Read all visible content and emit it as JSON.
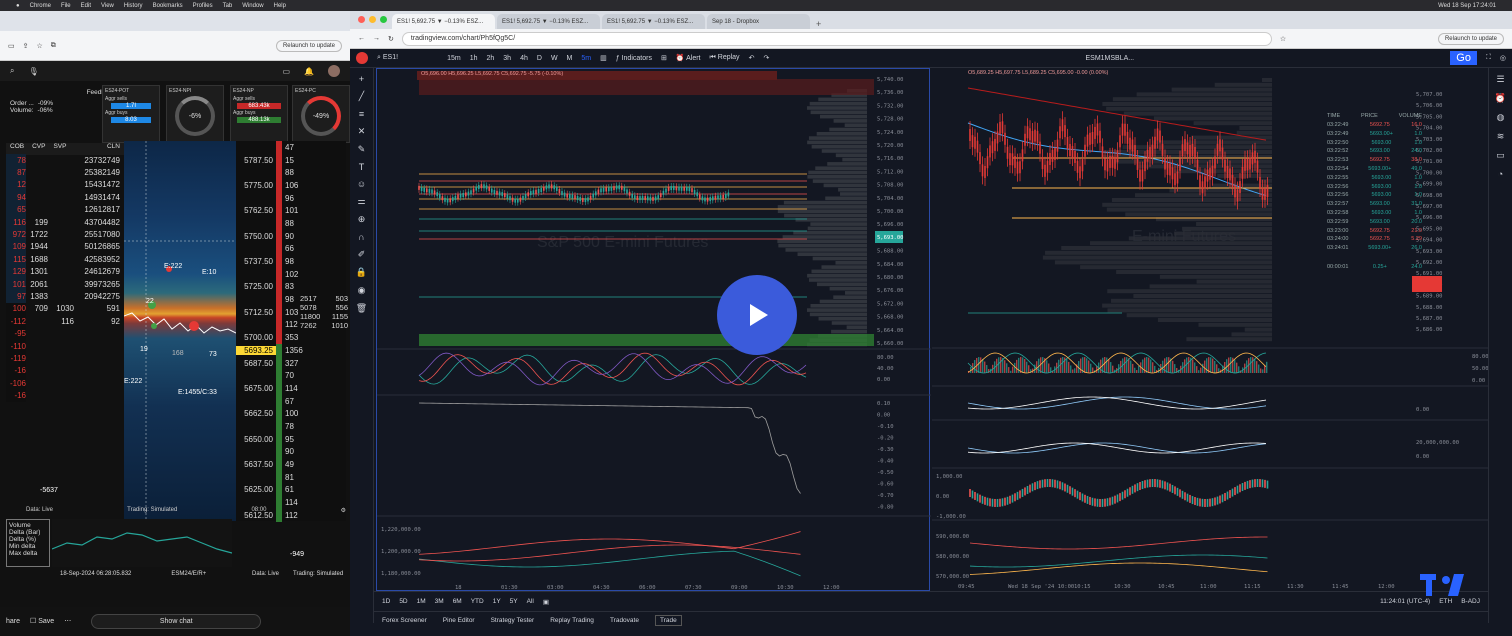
{
  "macbar": {
    "app": "Chrome",
    "menus": [
      "File",
      "Edit",
      "View",
      "History",
      "Bookmarks",
      "Profiles",
      "Tab",
      "Window",
      "Help"
    ],
    "clock": "Wed 18 Sep  17:24:01"
  },
  "left": {
    "url_relaunch": "Relaunch to update",
    "feedback": "Feedb",
    "order_label": "Order ...",
    "order_val": "-09%",
    "volume_label": "Volume:",
    "volume_val": "-06%",
    "gauges": [
      {
        "title": "ES24-POT",
        "a": "Aggr sells",
        "av": "1.7I",
        "b": "Aggr buys",
        "bv": "8.03"
      },
      {
        "title": "ES24-NPI",
        "val": "-6%",
        "sub": "-151.23k"
      },
      {
        "title": "ES24-NP",
        "a": "Aggr sells",
        "av": "683.43k",
        "b": "Aggr buys",
        "bv": "488.13k"
      },
      {
        "title": "ES24-PC",
        "val": "-49%",
        "sub": "5693.25"
      }
    ],
    "dom_headers": [
      "COB",
      "CVP",
      "SVP",
      "CLN"
    ],
    "dom_rows": [
      {
        "a": "78",
        "b": "",
        "c": "",
        "d": "23732749"
      },
      {
        "a": "87",
        "b": "",
        "c": "",
        "d": "25382149"
      },
      {
        "a": "12",
        "b": "",
        "c": "",
        "d": "15431472"
      },
      {
        "a": "94",
        "b": "",
        "c": "",
        "d": "14931474"
      },
      {
        "a": "65",
        "b": "",
        "c": "",
        "d": "12612817"
      },
      {
        "a": "116",
        "b": "199",
        "c": "",
        "d": "43704482"
      },
      {
        "a": "972",
        "b": "1722",
        "c": "",
        "d": "25517080"
      },
      {
        "a": "109",
        "b": "1944",
        "c": "",
        "d": "50126865"
      },
      {
        "a": "115",
        "b": "1688",
        "c": "",
        "d": "42583952"
      },
      {
        "a": "129",
        "b": "1301",
        "c": "",
        "d": "24612679"
      },
      {
        "a": "101",
        "b": "2061",
        "c": "",
        "d": "39973265"
      },
      {
        "a": "97",
        "b": "1383",
        "c": "",
        "d": "20942275"
      },
      {
        "a": "100",
        "b": "709",
        "c": "1030",
        "d": "591"
      },
      {
        "a": "-112",
        "b": "",
        "c": "116",
        "d": "92"
      },
      {
        "a": "-95",
        "b": "",
        "c": "",
        "d": ""
      },
      {
        "a": "-110",
        "b": "",
        "c": "",
        "d": ""
      },
      {
        "a": "-119",
        "b": "",
        "c": "",
        "d": ""
      },
      {
        "a": "-16",
        "b": "",
        "c": "",
        "d": ""
      },
      {
        "a": "-106",
        "b": "",
        "c": "",
        "d": ""
      },
      {
        "a": "-16",
        "b": "",
        "c": "",
        "d": ""
      }
    ],
    "heat_labels": [
      {
        "t": "E:222"
      },
      {
        "t": "E:10"
      },
      {
        "t": "22"
      },
      {
        "t": "19"
      },
      {
        "t": "168"
      },
      {
        "t": "73"
      },
      {
        "t": "E:222"
      },
      {
        "t": "E:1455/C:33"
      }
    ],
    "ladder_rows": [
      {
        "p": "",
        "v": "47"
      },
      {
        "p": "5787.50",
        "v": "15"
      },
      {
        "p": "",
        "v": "88"
      },
      {
        "p": "5775.00",
        "v": "106"
      },
      {
        "p": "",
        "v": "96"
      },
      {
        "p": "5762.50",
        "v": "101"
      },
      {
        "p": "",
        "v": "88"
      },
      {
        "p": "5750.00",
        "v": "90"
      },
      {
        "p": "",
        "v": "66"
      },
      {
        "p": "5737.50",
        "v": "98"
      },
      {
        "p": "",
        "v": "102"
      },
      {
        "p": "5725.00",
        "v": "83"
      },
      {
        "p": "",
        "v": "98"
      },
      {
        "p": "5712.50",
        "v": "103"
      },
      {
        "p": "",
        "v": "112"
      },
      {
        "p": "5700.00",
        "v": "353"
      },
      {
        "p": "5693.25",
        "v": "1356"
      },
      {
        "p": "5687.50",
        "v": "327"
      },
      {
        "p": "",
        "v": "70"
      },
      {
        "p": "5675.00",
        "v": "114"
      },
      {
        "p": "",
        "v": "67"
      },
      {
        "p": "5662.50",
        "v": "100"
      },
      {
        "p": "",
        "v": "78"
      },
      {
        "p": "5650.00",
        "v": "95"
      },
      {
        "p": "",
        "v": "90"
      },
      {
        "p": "5637.50",
        "v": "49"
      },
      {
        "p": "",
        "v": "81"
      },
      {
        "p": "5625.00",
        "v": "61"
      },
      {
        "p": "",
        "v": "114"
      },
      {
        "p": "5612.50",
        "v": "112"
      }
    ],
    "ladder_side": [
      "2517",
      "503",
      "5078",
      "556",
      "11800",
      "1155",
      "7262",
      "1010"
    ],
    "cvd_val": "-5637",
    "status_live": "Data: Live",
    "status_sim": "Trading: Simulated",
    "time_label": "08:00",
    "mini_val": "-949",
    "legend": [
      "Volume",
      "Delta (Bar)",
      "Delta (%)",
      "Min delta",
      "Max delta"
    ],
    "mini_time": "18-Sep-2024 06:28:05.832",
    "mini_sym": "ESM24/E/R+",
    "share": "hare",
    "save": "Save",
    "chat": "Show chat"
  },
  "right": {
    "tabs": [
      "ES1! 5,692.75 ▼ −0.13% ESZ...",
      "ES1! 5,692.75 ▼ −0.13% ESZ...",
      "ES1! 5,692.75 ▼ −0.13% ESZ...",
      "Sep 18 - Dropbox"
    ],
    "url": "tradingview.com/chart/Ph5fQg5C/",
    "relaunch": "Relaunch to update",
    "symbol": "ES1!",
    "intervals": [
      "15m",
      "1h",
      "2h",
      "3h",
      "4h",
      "D",
      "W",
      "M",
      "5m"
    ],
    "indicators": "Indicators",
    "alert": "Alert",
    "replay": "Replay",
    "go": "Go",
    "right_symbol": "ESM1MSBLA...",
    "ohlc_left": "O5,696.00 H5,696.25 L5,692.75 C5,692.75 -5.75 (-0.10%)",
    "ohlc_right": "O5,689.25 H5,697.75 L5,689.25 C5,695.00 -0.00 (0.00%)",
    "watermark_left": "S&P 500 E-mini Futures",
    "watermark_right": "E-mini Futures",
    "price_axis_left": [
      "5,740.00",
      "5,736.00",
      "5,732.00",
      "5,728.00",
      "5,724.00",
      "5,720.00",
      "5,716.00",
      "5,712.00",
      "5,708.00",
      "5,704.00",
      "5,700.00",
      "5,696.00",
      "5,692.00",
      "5,688.00",
      "5,684.00",
      "5,680.00",
      "5,676.00",
      "5,672.00",
      "5,668.00",
      "5,664.00",
      "5,660.00"
    ],
    "price_axis_right": [
      "5,707.00",
      "5,706.00",
      "5,705.00",
      "5,704.00",
      "5,703.00",
      "5,702.00",
      "5,701.00",
      "5,700.00",
      "5,699.00",
      "5,698.00",
      "5,697.00",
      "5,696.00",
      "5,695.00",
      "5,694.00",
      "5,693.00",
      "5,692.00",
      "5,691.00",
      "5,690.00",
      "5,689.00",
      "5,688.00",
      "5,687.00",
      "5,686.00"
    ],
    "last_price": "5,693.00",
    "osc_axis": [
      "80.00",
      "40.00",
      "0.00"
    ],
    "osc_axis_r": [
      "80.00",
      "50.00",
      "0.00"
    ],
    "delta_axis": [
      "0.10",
      "0.00",
      "-0.10",
      "-0.20",
      "-0.30",
      "-0.40",
      "-0.50",
      "-0.60",
      "-0.70",
      "-0.80"
    ],
    "vol_axis": [
      "1,220,000.00",
      "1,200,000.00",
      "1,180,000.00"
    ],
    "mid_axis_r": [
      "1,000.00",
      "0.00",
      "-1,000.00"
    ],
    "bot_axis_r": [
      "590,000.00",
      "580,000.00",
      "570,000.00"
    ],
    "r_axis_misc": [
      "0.00",
      "20,000,000.00",
      "0.00"
    ],
    "time_axis_left": [
      "18",
      "01:30",
      "03:00",
      "04:30",
      "06:00",
      "07:30",
      "09:00",
      "10:30",
      "12:00"
    ],
    "time_axis_right": [
      "09:45",
      "Wed 18 Sep '24  10:00",
      "10:15",
      "10:30",
      "10:45",
      "11:00",
      "11:15",
      "11:30",
      "11:45",
      "12:00"
    ],
    "tape_headers": [
      "TIME",
      "PRICE",
      "VOLUME"
    ],
    "tape": [
      {
        "t": "03:22:49",
        "p": "5692.75",
        "v": "16.0",
        "s": "sell"
      },
      {
        "t": "03:22:49",
        "p": "5693.00+",
        "v": "1.0",
        "s": "buy"
      },
      {
        "t": "03:22:50",
        "p": "5693.00",
        "v": "1.0",
        "s": "buy"
      },
      {
        "t": "03:22:52",
        "p": "5693.00",
        "v": "24.0",
        "s": "buy"
      },
      {
        "t": "03:22:53",
        "p": "5692.75",
        "v": "38.0",
        "s": "sell"
      },
      {
        "t": "03:22:54",
        "p": "5693.00+",
        "v": "49.0",
        "s": "buy"
      },
      {
        "t": "03:22:55",
        "p": "5693.00",
        "v": "1.0",
        "s": "buy"
      },
      {
        "t": "03:22:56",
        "p": "5693.00",
        "v": "1.0",
        "s": "buy"
      },
      {
        "t": "03:22:56",
        "p": "5693.00",
        "v": "1.0",
        "s": "buy"
      },
      {
        "t": "03:22:57",
        "p": "5693.00",
        "v": "31.0",
        "s": "buy"
      },
      {
        "t": "03:22:58",
        "p": "5693.00",
        "v": "1.0",
        "s": "buy"
      },
      {
        "t": "03:22:59",
        "p": "5693.00",
        "v": "20.0",
        "s": "buy"
      },
      {
        "t": "03:23:00",
        "p": "5692.75",
        "v": "21.0",
        "s": "sell"
      },
      {
        "t": "03:24:00",
        "p": "5692.75",
        "v": "5.29",
        "s": "sell"
      },
      {
        "t": "03:24:01",
        "p": "5693.00+",
        "v": "26.0",
        "s": "buy"
      }
    ],
    "tape_footer": {
      "t": "00:00:01",
      "p": "0.25+",
      "v": "24.0"
    },
    "ranges": [
      "1D",
      "5D",
      "1M",
      "3M",
      "6M",
      "YTD",
      "1Y",
      "5Y",
      "All"
    ],
    "clock": "11:24:01 (UTC-4)",
    "eth": "ETH",
    "badj": "B-ADJ",
    "bottom_tabs": [
      "Forex Screener",
      "Pine Editor",
      "Strategy Tester",
      "Replay Trading",
      "Tradovate",
      "Trade"
    ]
  },
  "colors": {
    "up": "#26a69a",
    "down": "#ef5350",
    "accent": "#2962ff",
    "orange": "#ffb74d",
    "green": "#00c853",
    "red": "#e53935"
  }
}
